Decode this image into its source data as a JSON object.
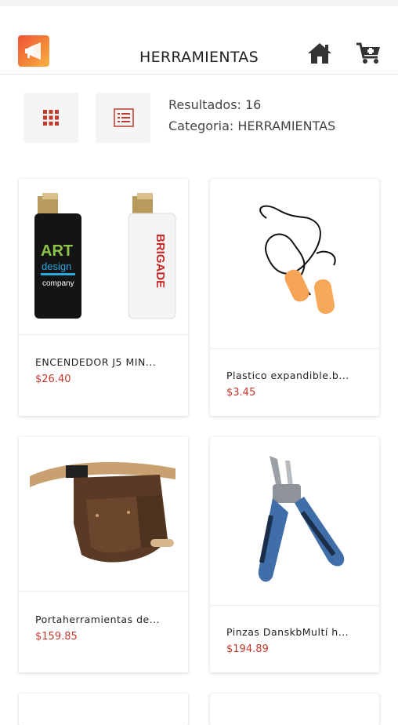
{
  "header": {
    "title": "HERRAMIENTAS"
  },
  "icons": {
    "logo": "megaphone-icon",
    "home": "home-icon",
    "cart": "add-to-cart-icon",
    "grid": "grid-view-icon",
    "list": "list-view-icon"
  },
  "results": {
    "count_text": "Resultados: 16",
    "category_text": "Categoria: HERRAMIENTAS"
  },
  "colors": {
    "accent": "#c0392b",
    "logo_start": "#ef5233",
    "logo_end": "#f7b344"
  },
  "products": [
    {
      "name": "ENCENDEDOR J5 MIN...",
      "price": "$26.40"
    },
    {
      "name": "Plastico expandible.b...",
      "price": "$3.45"
    },
    {
      "name": "Portaherramientas de...",
      "price": "$159.85"
    },
    {
      "name": "Pinzas DanskbMultí h...",
      "price": "$194.89"
    }
  ],
  "product_images": {
    "lighter_logo_text": [
      "ART",
      "design",
      "company"
    ],
    "lighter_brand_text": "BRIGADE"
  }
}
